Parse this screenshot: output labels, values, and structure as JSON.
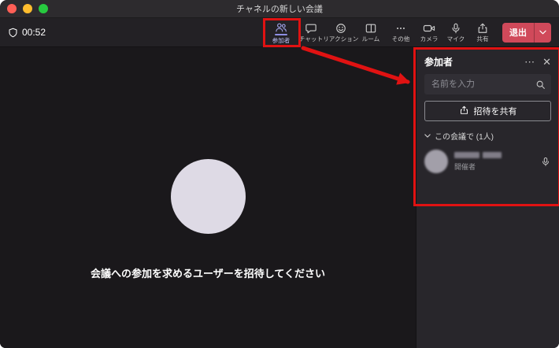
{
  "window": {
    "title": "チャネルの新しい会議"
  },
  "toolbar": {
    "timer": "00:52",
    "tabs": [
      {
        "label": "参加者",
        "active": true
      },
      {
        "label": "チャット",
        "active": false
      },
      {
        "label": "リアクション",
        "active": false
      },
      {
        "label": "ルーム",
        "active": false
      },
      {
        "label": "その他",
        "active": false
      }
    ],
    "device_buttons": [
      {
        "label": "カメラ"
      },
      {
        "label": "マイク"
      },
      {
        "label": "共有"
      }
    ],
    "leave": {
      "label": "退出"
    }
  },
  "stage": {
    "invite_message": "会議への参加を求めるユーザーを招待してください"
  },
  "panel": {
    "title": "参加者",
    "search": {
      "placeholder": "名前を入力"
    },
    "share_invite_label": "招待を共有",
    "section_header": "この会議で (1人)",
    "participants": [
      {
        "name_redacted": true,
        "role": "開催者"
      }
    ]
  },
  "colors": {
    "annotation_red": "#e01212",
    "leave_button": "#d0495a",
    "active_accent": "#8d8ee3",
    "avatar_placeholder": "#dedae5",
    "panel_background": "#28262b",
    "toolbar_background": "#232125",
    "stage_background": "#1a181b"
  }
}
